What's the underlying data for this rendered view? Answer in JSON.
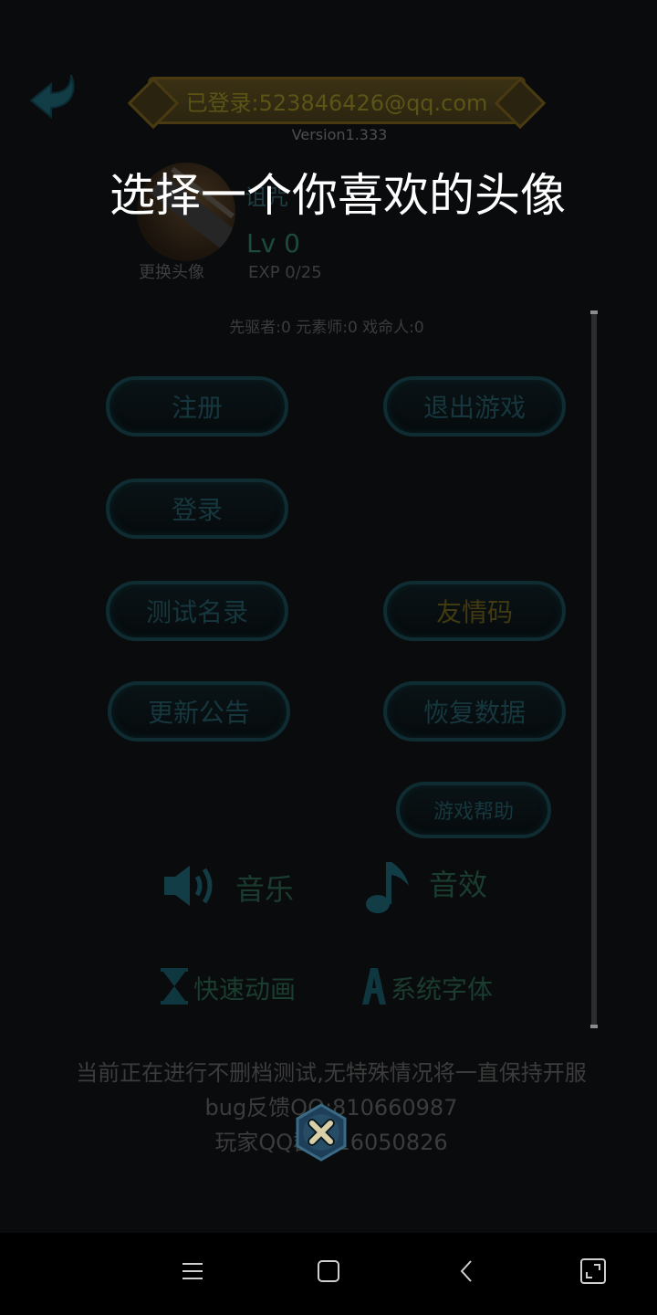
{
  "header": {
    "account_text": "已登录:523846426@qq.com",
    "version": "Version1.333"
  },
  "overlay": {
    "title": "选择一个你喜欢的头像"
  },
  "profile": {
    "name": "诅咒",
    "change_avatar": "更换头像",
    "level": "Lv 0",
    "exp": "EXP 0/25",
    "class_stats": "先驱者:0  元素师:0  戏命人:0"
  },
  "buttons": {
    "register": "注册",
    "exit_game": "退出游戏",
    "login": "登录",
    "test_list": "测试名录",
    "friend_code": "友情码",
    "update_notice": "更新公告",
    "restore_data": "恢复数据",
    "game_help": "游戏帮助"
  },
  "options": {
    "music": "音乐",
    "sound": "音效",
    "fast_anim": "快速动画",
    "system_font": "系统字体"
  },
  "notice": {
    "line1": "当前正在进行不删档测试,无特殊情况将一直保持开服",
    "line2": "bug反馈QQ:810660987",
    "line3": "玩家QQ群:816050826"
  },
  "colors": {
    "overlay_text": "#ffffff",
    "dim_teal": "#16373e",
    "dim_gold": "#423a10"
  },
  "icons": {
    "back": "back-arrow-icon",
    "music": "speaker-icon",
    "sound": "music-note-icon",
    "fast_anim": "hourglass-icon",
    "font": "font-a-icon",
    "close": "close-x-icon"
  }
}
